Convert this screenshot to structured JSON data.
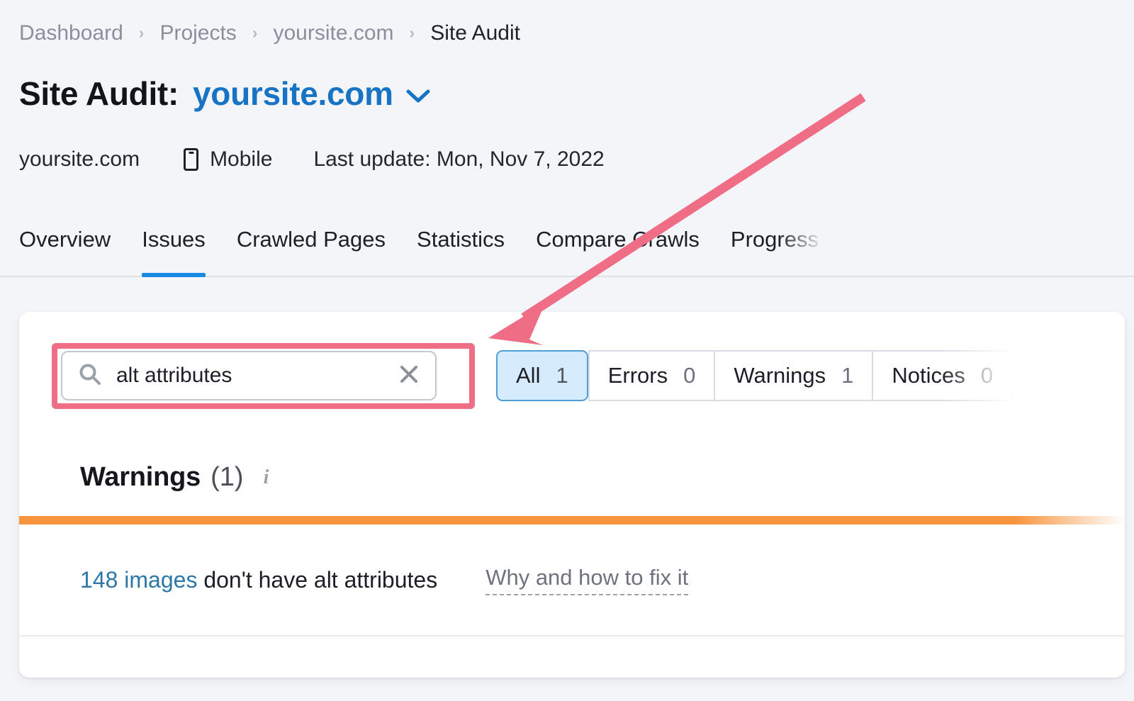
{
  "breadcrumb": {
    "items": [
      {
        "label": "Dashboard"
      },
      {
        "label": "Projects"
      },
      {
        "label": "yoursite.com"
      },
      {
        "label": "Site Audit"
      }
    ],
    "separator": "›"
  },
  "header": {
    "title_prefix": "Site Audit:",
    "domain": "yoursite.com",
    "chevron_icon": "chevron-down-icon",
    "meta": {
      "domain": "yoursite.com",
      "device_icon": "mobile-phone-icon",
      "device": "Mobile",
      "last_update": "Last update: Mon, Nov 7, 2022"
    }
  },
  "tabs": [
    {
      "label": "Overview",
      "active": false
    },
    {
      "label": "Issues",
      "active": true
    },
    {
      "label": "Crawled Pages",
      "active": false
    },
    {
      "label": "Statistics",
      "active": false
    },
    {
      "label": "Compare Crawls",
      "active": false
    },
    {
      "label": "Progress",
      "active": false
    }
  ],
  "toolbar": {
    "search": {
      "icon": "search-icon",
      "value": "alt attributes",
      "placeholder": "Search",
      "clear_icon": "close-icon"
    },
    "filters": [
      {
        "label": "All",
        "count": "1",
        "active": true
      },
      {
        "label": "Errors",
        "count": "0",
        "active": false
      },
      {
        "label": "Warnings",
        "count": "1",
        "active": false
      },
      {
        "label": "Notices",
        "count": "0",
        "active": false
      }
    ]
  },
  "section": {
    "title": "Warnings",
    "count": "(1)",
    "info_icon": "info-icon"
  },
  "issue": {
    "count_link": "148 images",
    "text": " don't have alt attributes",
    "fix_link": "Why and how to fix it"
  },
  "annotation": {
    "arrow_color": "#ef6e86",
    "highlight_color": "#ef6e86"
  },
  "colors": {
    "accent_blue": "#1774c4",
    "tab_active": "#168ae2",
    "severity_warning": "#f7943e",
    "link": "#2c77a6",
    "filter_active_bg": "#d6ebfb"
  }
}
